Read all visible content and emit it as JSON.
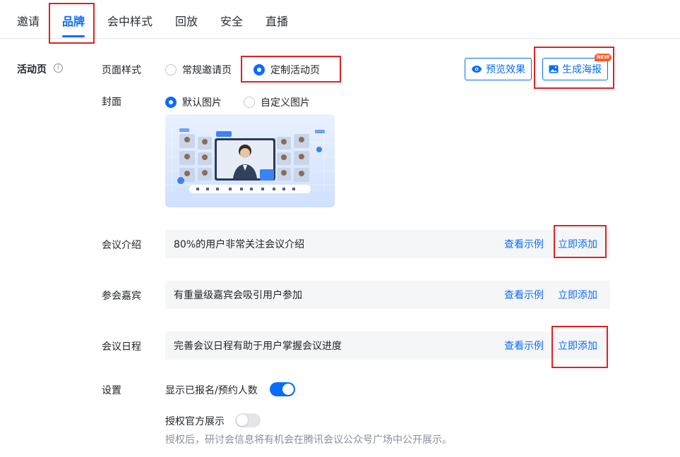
{
  "tabs": [
    {
      "label": "邀请",
      "active": false
    },
    {
      "label": "品牌",
      "active": true
    },
    {
      "label": "会中样式",
      "active": false
    },
    {
      "label": "回放",
      "active": false
    },
    {
      "label": "安全",
      "active": false
    },
    {
      "label": "直播",
      "active": false
    }
  ],
  "section": {
    "title": "活动页"
  },
  "page_style": {
    "label": "页面样式",
    "options": [
      {
        "label": "常规邀请页",
        "checked": false
      },
      {
        "label": "定制活动页",
        "checked": true
      }
    ]
  },
  "actions": {
    "preview_label": "预览效果",
    "poster_label": "生成海报",
    "new_badge": "NEW"
  },
  "cover": {
    "label": "封面",
    "options": [
      {
        "label": "默认图片",
        "checked": true
      },
      {
        "label": "自定义图片",
        "checked": false
      }
    ]
  },
  "info_rows": [
    {
      "label": "会议介绍",
      "text": "80%的用户非常关注会议介绍",
      "example_link": "查看示例",
      "add_link": "立即添加"
    },
    {
      "label": "参会嘉宾",
      "text": "有重量级嘉宾会吸引用户参加",
      "example_link": "查看示例",
      "add_link": "立即添加"
    },
    {
      "label": "会议日程",
      "text": "完善会议日程有助于用户掌握会议进度",
      "example_link": "查看示例",
      "add_link": "立即添加"
    }
  ],
  "settings": {
    "label": "设置",
    "show_count_label": "显示已报名/预约人数",
    "show_count_enabled": true,
    "official_label": "授权官方展示",
    "official_enabled": false,
    "official_hint": "授权后，研讨会信息将有机会在腾讯会议公众号广场中公开展示。"
  },
  "colors": {
    "accent": "#0a6cff",
    "highlight_box": "#e02121",
    "row_bg": "#f5f6f7"
  }
}
